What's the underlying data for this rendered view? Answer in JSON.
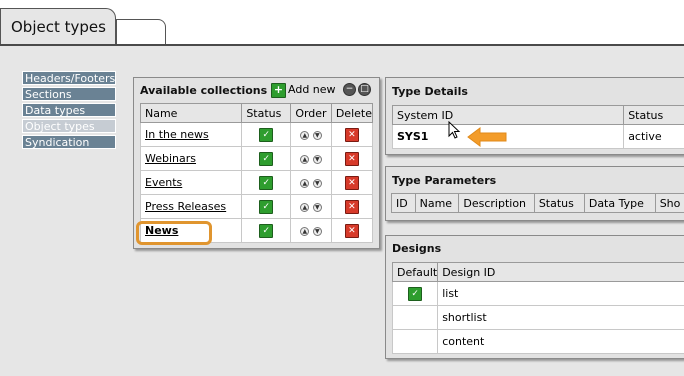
{
  "tabs": {
    "active_label": "Object types"
  },
  "nav": {
    "items": [
      {
        "label": "Headers/Footers"
      },
      {
        "label": "Sections"
      },
      {
        "label": "Data types"
      },
      {
        "label": "Object types"
      },
      {
        "label": "Syndication"
      }
    ]
  },
  "collections": {
    "title": "Available collections",
    "add_new": "Add new",
    "headers": {
      "name": "Name",
      "status": "Status",
      "order": "Order",
      "delete": "Delete"
    },
    "rows": [
      {
        "name": "In the news"
      },
      {
        "name": "Webinars"
      },
      {
        "name": "Events"
      },
      {
        "name": "Press Releases"
      },
      {
        "name": "News"
      }
    ]
  },
  "type_details": {
    "title": "Type Details",
    "headers": {
      "system_id": "System ID",
      "status": "Status"
    },
    "row": {
      "system_id": "SYS1",
      "status": "active"
    }
  },
  "type_parameters": {
    "title": "Type Parameters",
    "headers": {
      "id": "ID",
      "name": "Name",
      "description": "Description",
      "status": "Status",
      "data_type": "Data Type",
      "show": "Sho"
    }
  },
  "designs": {
    "title": "Designs",
    "headers": {
      "default": "Default",
      "design_id": "Design ID"
    },
    "rows": [
      {
        "design_id": "list"
      },
      {
        "design_id": "shortlist"
      },
      {
        "design_id": "content"
      }
    ]
  },
  "colors": {
    "nav_bg": "#6a8294",
    "nav_active_bg": "#c6ccd3",
    "highlight": "#e0952f",
    "arrow": "#f39c2a",
    "check": "#2e9d2e",
    "delete": "#d73a2a"
  }
}
